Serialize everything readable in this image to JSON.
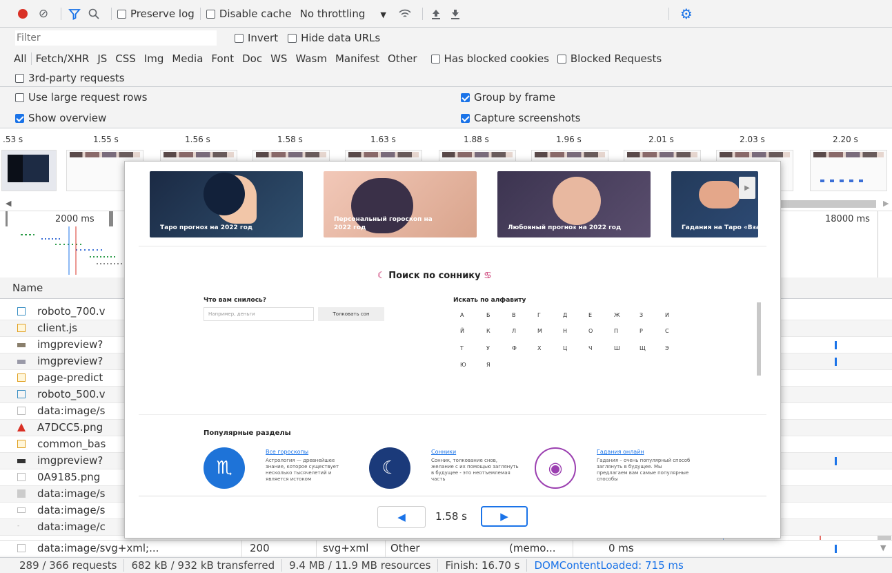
{
  "toolbar": {
    "preserve_log": "Preserve log",
    "disable_cache": "Disable cache",
    "throttling": "No throttling"
  },
  "filter": {
    "placeholder": "Filter",
    "invert": "Invert",
    "hide_data_urls": "Hide data URLs"
  },
  "types": [
    "All",
    "Fetch/XHR",
    "JS",
    "CSS",
    "Img",
    "Media",
    "Font",
    "Doc",
    "WS",
    "Wasm",
    "Manifest",
    "Other"
  ],
  "has_blocked_cookies": "Has blocked cookies",
  "blocked_requests": "Blocked Requests",
  "third_party": "3rd-party requests",
  "settings": {
    "large_rows": "Use large request rows",
    "group_by_frame": "Group by frame",
    "show_overview": "Show overview",
    "capture_screenshots": "Capture screenshots"
  },
  "filmstrip_times": [
    ".53 s",
    "1.55 s",
    "1.56 s",
    "1.58 s",
    "1.63 s",
    "1.88 s",
    "1.96 s",
    "2.01 s",
    "2.03 s",
    "2.20 s"
  ],
  "overview": {
    "left_label": "2000 ms",
    "right_label": "18000 ms"
  },
  "columns": {
    "name": "Name"
  },
  "rows": [
    {
      "name": "roboto_700.v",
      "icon": "font"
    },
    {
      "name": "client.js",
      "icon": "script"
    },
    {
      "name": "imgpreview?",
      "icon": "image"
    },
    {
      "name": "imgpreview?",
      "icon": "image"
    },
    {
      "name": "page-predict",
      "icon": "script"
    },
    {
      "name": "roboto_500.v",
      "icon": "font"
    },
    {
      "name": "data:image/s",
      "icon": "file"
    },
    {
      "name": "A7DCC5.png",
      "icon": "png-error"
    },
    {
      "name": "common_bas",
      "icon": "script"
    },
    {
      "name": "imgpreview?",
      "icon": "image"
    },
    {
      "name": "0A9185.png",
      "icon": "file"
    },
    {
      "name": "data:image/s",
      "icon": "image"
    },
    {
      "name": "data:image/s",
      "icon": "file"
    },
    {
      "name": "data:image/c",
      "icon": "file"
    }
  ],
  "last_row": {
    "name": "data:image/svg+xml;...",
    "status": "200",
    "type": "svg+xml",
    "initiator": "Other",
    "size": "(memo...",
    "time": "0 ms"
  },
  "preview": {
    "cards": [
      "Таро прогноз на 2022 год",
      "Персональный гороскоп на 2022 год",
      "Любовный прогноз на 2022 год",
      "Гадания на Таро «Взаимоотнош"
    ],
    "search_title": "Поиск по соннику",
    "question": "Что вам снилось?",
    "input_placeholder": "Например, деньги",
    "button": "Толковать сон",
    "alphabet_title": "Искать по алфавиту",
    "letters": [
      "А",
      "Б",
      "В",
      "Г",
      "Д",
      "Е",
      "Ж",
      "З",
      "И",
      "Й",
      "К",
      "Л",
      "М",
      "Н",
      "О",
      "П",
      "Р",
      "С",
      "Т",
      "У",
      "Ф",
      "Х",
      "Ц",
      "Ч",
      "Ш",
      "Щ",
      "Э",
      "Ю",
      "Я"
    ],
    "popular_title": "Популярные разделы",
    "sections": [
      {
        "title": "Все гороскопы",
        "desc": "Астрология — древнейшее знание, которое существует несколько тысячелетий и является истоком"
      },
      {
        "title": "Сонники",
        "desc": "Сонник, толкование снов, желание с их помощью заглянуть в будущее - это неотъемлемая часть"
      },
      {
        "title": "Гадания онлайн",
        "desc": "Гадания – очень популярный способ заглянуть в будущее. Мы предлагаем вам самые популярные способы"
      }
    ],
    "time": "1.58 s"
  },
  "status": {
    "requests": "289 / 366 requests",
    "transferred": "682 kB / 932 kB transferred",
    "resources": "9.4 MB / 11.9 MB resources",
    "finish": "Finish: 16.70 s",
    "dcl": "DOMContentLoaded: 715 ms"
  },
  "colors": {
    "accent": "#1a73e8",
    "record": "#d93025",
    "dcl": "#1a73e8"
  }
}
